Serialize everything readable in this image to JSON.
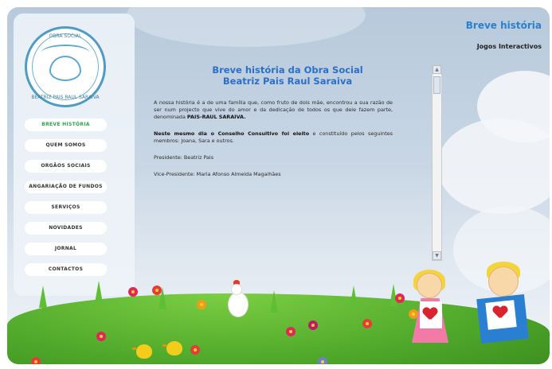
{
  "logo": {
    "text_top": "OBRA SOCIAL",
    "text_bottom": "BEATRIZ PAIS RAUL SARAIVA"
  },
  "top_links": {
    "title": "Breve história",
    "sub": "Jogos Interactivos"
  },
  "nav": [
    {
      "label": "BREVE HISTÓRIA",
      "active": true
    },
    {
      "label": "QUEM SOMOS",
      "active": false
    },
    {
      "label": "ORGÃOS SOCIAIS",
      "active": false
    },
    {
      "label": "ANGARIAÇÃO DE FUNDOS",
      "active": false
    },
    {
      "label": "SERVIÇOS",
      "active": false
    },
    {
      "label": "NOVIDADES",
      "active": false
    },
    {
      "label": "JORNAL",
      "active": false
    },
    {
      "label": "CONTACTOS",
      "active": false
    }
  ],
  "content": {
    "heading_line1": "Breve história da Obra Social",
    "heading_line2": "Beatriz Pais Raul Saraiva",
    "para1_text": "A nossa história é a de uma família que, como fruto de dois mãe, encontrou a sua razão de ser num projecto que vive do amor e da dedicação de todos os que dele fazem parte, denominada ",
    "para1_strong": "PAIS-RAUL SARAIVA.",
    "para2_strong": "Neste mesmo dia o Conselho Consultivo foi eleito",
    "para2_text": " e constituído pelos seguintes membros: Joana, Sara e outros.",
    "para3": "Presidente: Beatriz Pais",
    "para4": "Vice-Presidente: Maria Afonso Almeida Magalhães"
  },
  "colors": {
    "heading": "#2a6fc9",
    "nav_active": "#2aa84a",
    "link_title": "#2a7fd0",
    "grass": "#4fa82a"
  }
}
